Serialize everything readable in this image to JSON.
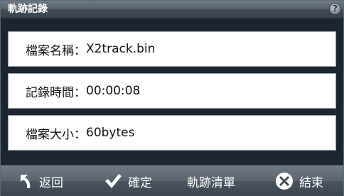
{
  "window": {
    "title": "軌跡記錄",
    "help_label": "?"
  },
  "info": {
    "file_name": {
      "label": "檔案名稱：",
      "value": "X2track.bin"
    },
    "record_time": {
      "label": "記錄時間：",
      "value": "00:00:08"
    },
    "file_size": {
      "label": "檔案大小：",
      "value": "60bytes"
    }
  },
  "toolbar": {
    "back_label": "返回",
    "confirm_label": "確定",
    "track_list_label": "軌跡清單",
    "end_label": "結束"
  },
  "icons": {
    "back": "back-arrow-icon",
    "confirm": "checkmark-icon",
    "end": "close-circle-icon",
    "help": "help-icon"
  }
}
